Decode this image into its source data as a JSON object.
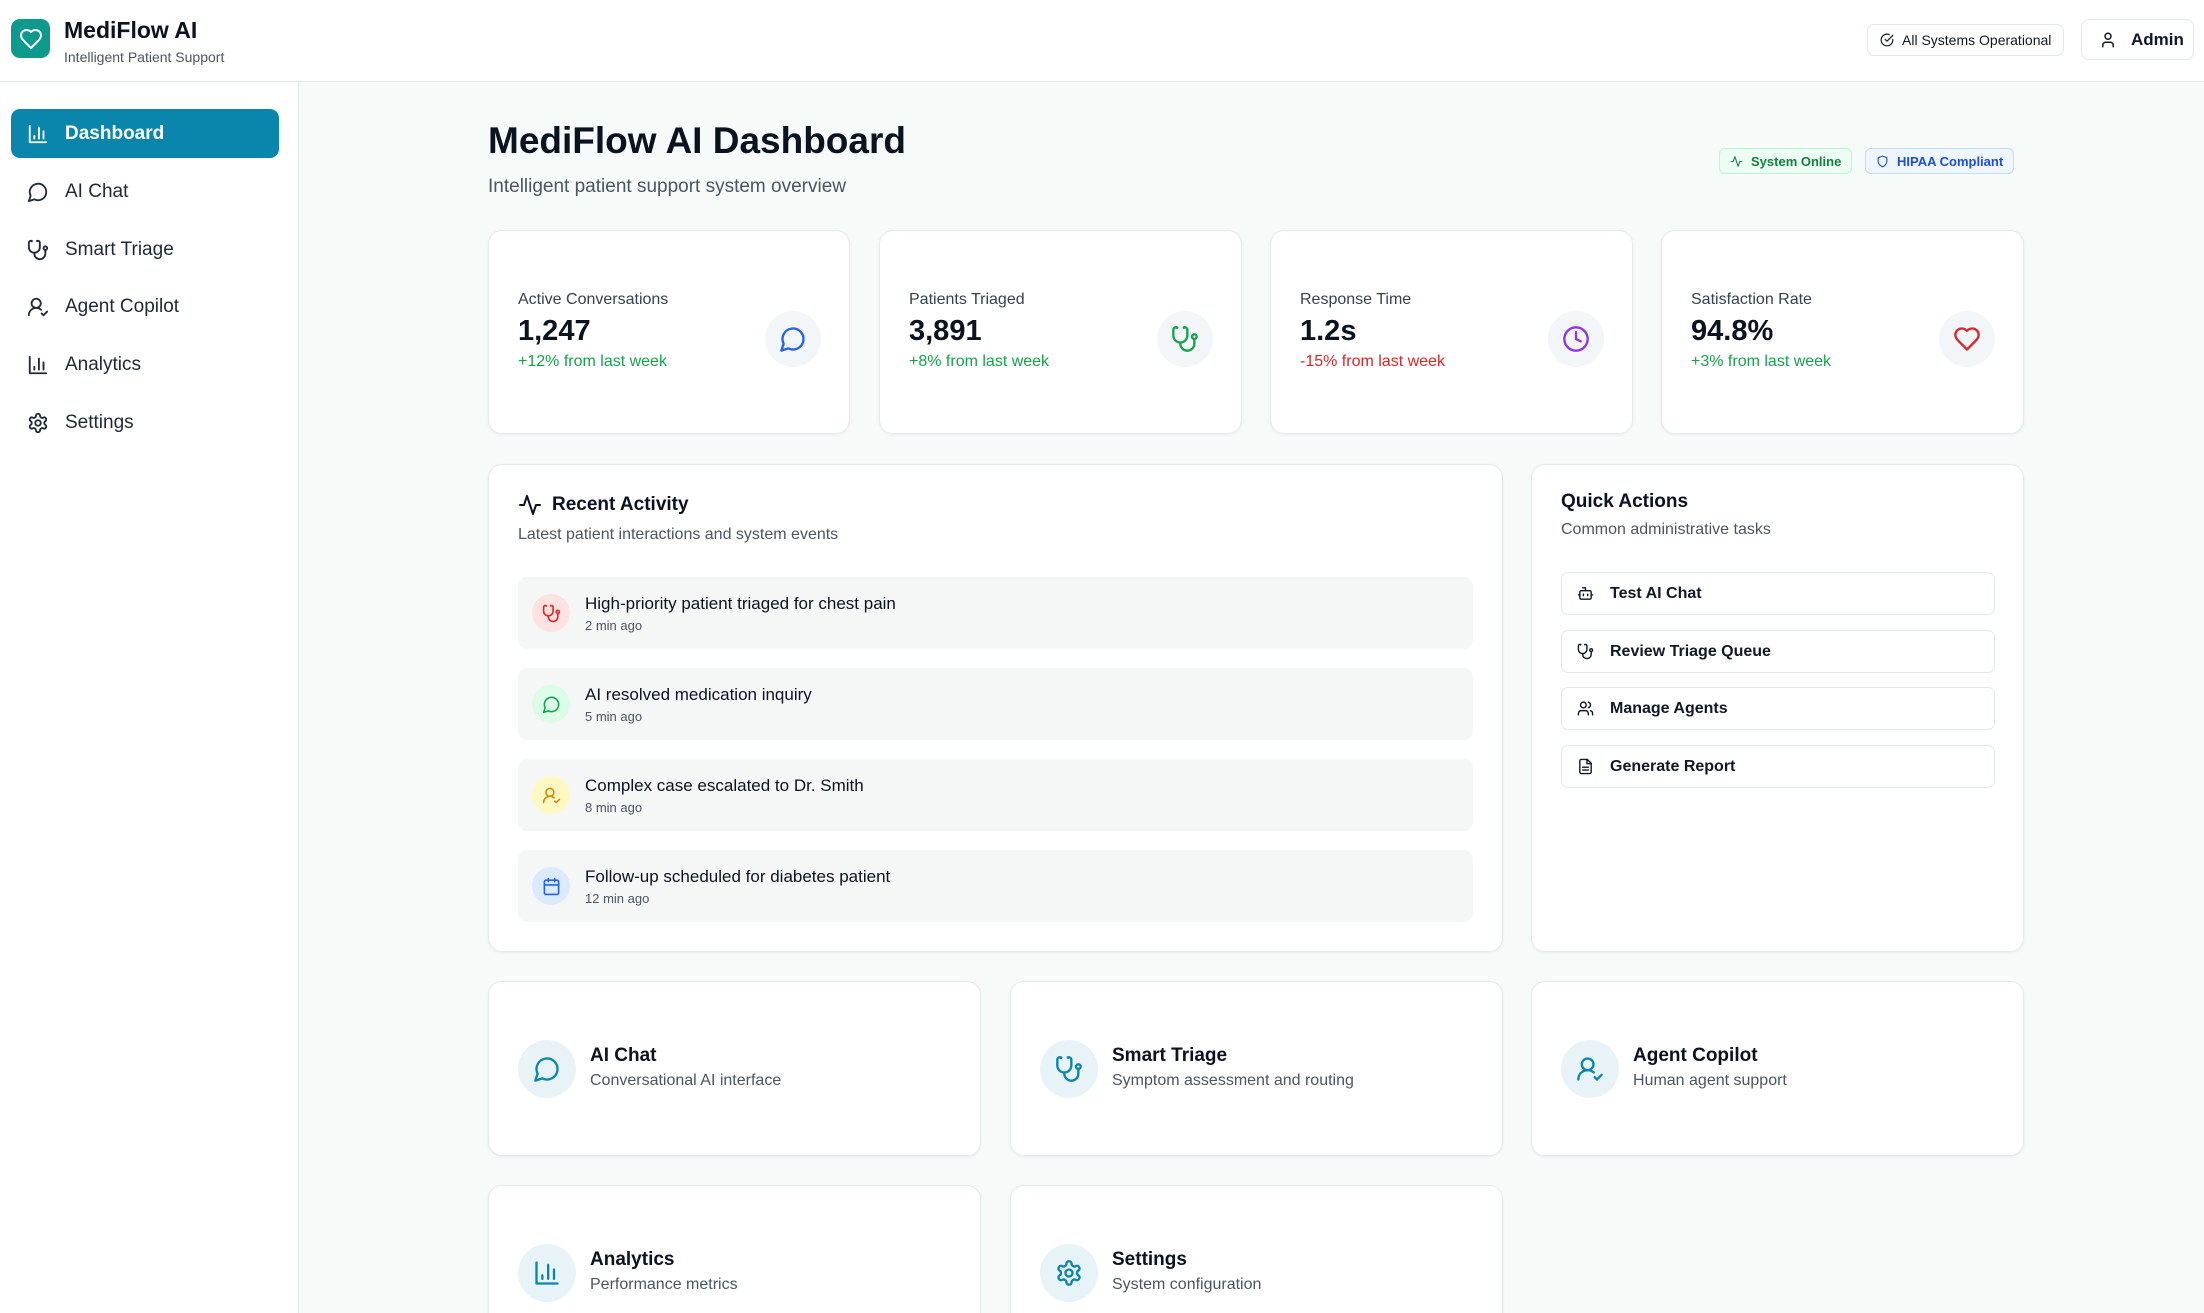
{
  "brand": {
    "name": "MediFlow AI",
    "tagline": "Intelligent Patient Support"
  },
  "header": {
    "status": "All Systems Operational",
    "user": "Admin"
  },
  "sidebar": {
    "items": [
      {
        "label": "Dashboard",
        "icon": "bar-chart-icon",
        "active": true
      },
      {
        "label": "AI Chat",
        "icon": "message-circle-icon"
      },
      {
        "label": "Smart Triage",
        "icon": "stethoscope-icon"
      },
      {
        "label": "Agent Copilot",
        "icon": "user-check-icon"
      },
      {
        "label": "Analytics",
        "icon": "bar-chart-icon"
      },
      {
        "label": "Settings",
        "icon": "gear-icon"
      }
    ]
  },
  "page": {
    "title": "MediFlow AI Dashboard",
    "subtitle": "Intelligent patient support system overview",
    "badges": {
      "online": "System Online",
      "hipaa": "HIPAA Compliant"
    }
  },
  "stats": [
    {
      "label": "Active Conversations",
      "value": "1,247",
      "change": "+12% from last week",
      "trend": "up",
      "icon": "message-circle-icon",
      "color": "#2563eb"
    },
    {
      "label": "Patients Triaged",
      "value": "3,891",
      "change": "+8% from last week",
      "trend": "up",
      "icon": "stethoscope-icon",
      "color": "#16a34a"
    },
    {
      "label": "Response Time",
      "value": "1.2s",
      "change": "-15% from last week",
      "trend": "down",
      "icon": "clock-icon",
      "color": "#9333ea"
    },
    {
      "label": "Satisfaction Rate",
      "value": "94.8%",
      "change": "+3% from last week",
      "trend": "up",
      "icon": "heart-icon",
      "color": "#dc2626"
    }
  ],
  "activity": {
    "title": "Recent Activity",
    "subtitle": "Latest patient interactions and system events",
    "items": [
      {
        "title": "High-priority patient triaged for chest pain",
        "time": "2 min ago",
        "icon": "stethoscope-icon",
        "color": "#dc2626",
        "bg": "#fee2e2"
      },
      {
        "title": "AI resolved medication inquiry",
        "time": "5 min ago",
        "icon": "message-circle-icon",
        "color": "#16a34a",
        "bg": "#dcfce7"
      },
      {
        "title": "Complex case escalated to Dr. Smith",
        "time": "8 min ago",
        "icon": "user-check-icon",
        "color": "#ca8a04",
        "bg": "#fef9c3"
      },
      {
        "title": "Follow-up scheduled for diabetes patient",
        "time": "12 min ago",
        "icon": "calendar-icon",
        "color": "#2563eb",
        "bg": "#dbeafe"
      }
    ]
  },
  "quick_actions": {
    "title": "Quick Actions",
    "subtitle": "Common administrative tasks",
    "items": [
      {
        "label": "Test AI Chat",
        "icon": "bot-icon"
      },
      {
        "label": "Review Triage Queue",
        "icon": "stethoscope-icon"
      },
      {
        "label": "Manage Agents",
        "icon": "users-icon"
      },
      {
        "label": "Generate Report",
        "icon": "file-text-icon"
      }
    ]
  },
  "features": [
    {
      "title": "AI Chat",
      "subtitle": "Conversational AI interface",
      "icon": "message-circle-icon"
    },
    {
      "title": "Smart Triage",
      "subtitle": "Symptom assessment and routing",
      "icon": "stethoscope-icon"
    },
    {
      "title": "Agent Copilot",
      "subtitle": "Human agent support",
      "icon": "user-check-icon"
    },
    {
      "title": "Analytics",
      "subtitle": "Performance metrics",
      "icon": "bar-chart-icon"
    },
    {
      "title": "Settings",
      "subtitle": "System configuration",
      "icon": "gear-icon"
    }
  ],
  "colors": {
    "primary": "#0a86ad",
    "brand": "#0d9a8c"
  }
}
